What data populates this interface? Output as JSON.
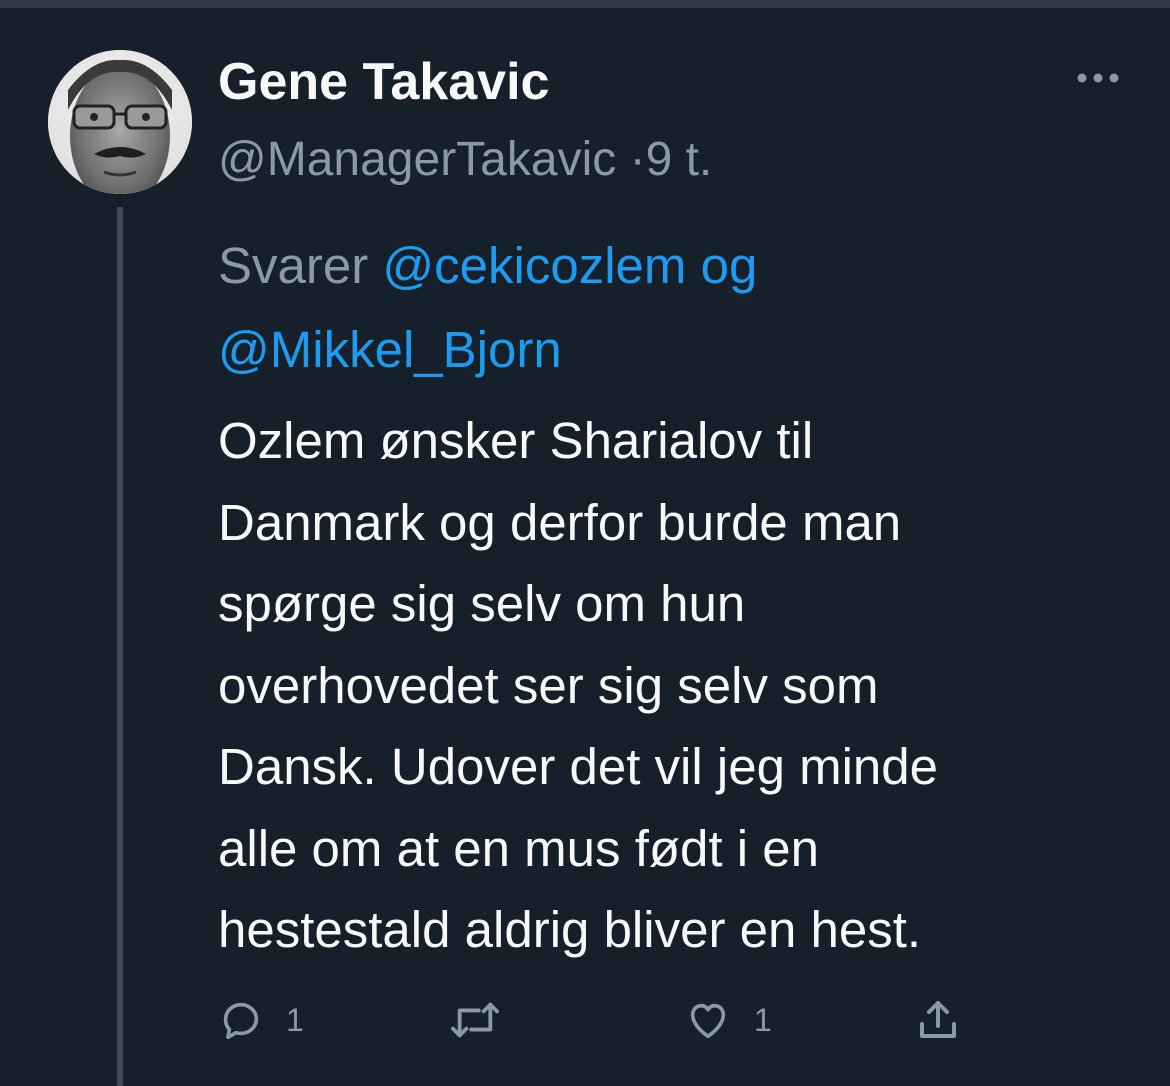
{
  "author": {
    "display_name": "Gene Takavic",
    "handle": "@ManagerTakavic",
    "separator": "·",
    "timestamp": "9 t."
  },
  "reply_context": {
    "prefix": "Svarer",
    "mentions": [
      "@cekicozlem",
      "@Mikkel_Bjorn"
    ],
    "joiner": "og"
  },
  "tweet": {
    "lines": [
      "Ozlem ønsker Sharialov til",
      "Danmark og derfor burde man",
      "spørge sig selv om hun",
      "overhovedet ser sig selv som",
      "Dansk. Udover det vil jeg minde",
      "alle om at en mus født i en",
      "hestestald aldrig bliver en hest."
    ]
  },
  "actions": {
    "reply": {
      "icon": "reply-icon",
      "count": "1"
    },
    "retweet": {
      "icon": "retweet-icon",
      "count": ""
    },
    "like": {
      "icon": "heart-icon",
      "count": "1"
    },
    "share": {
      "icon": "share-icon"
    }
  },
  "colors": {
    "background": "#16202b",
    "text": "#f7f9f9",
    "secondary": "#8b98a5",
    "link": "#1d9bf0",
    "thread_line": "#3d4954"
  }
}
